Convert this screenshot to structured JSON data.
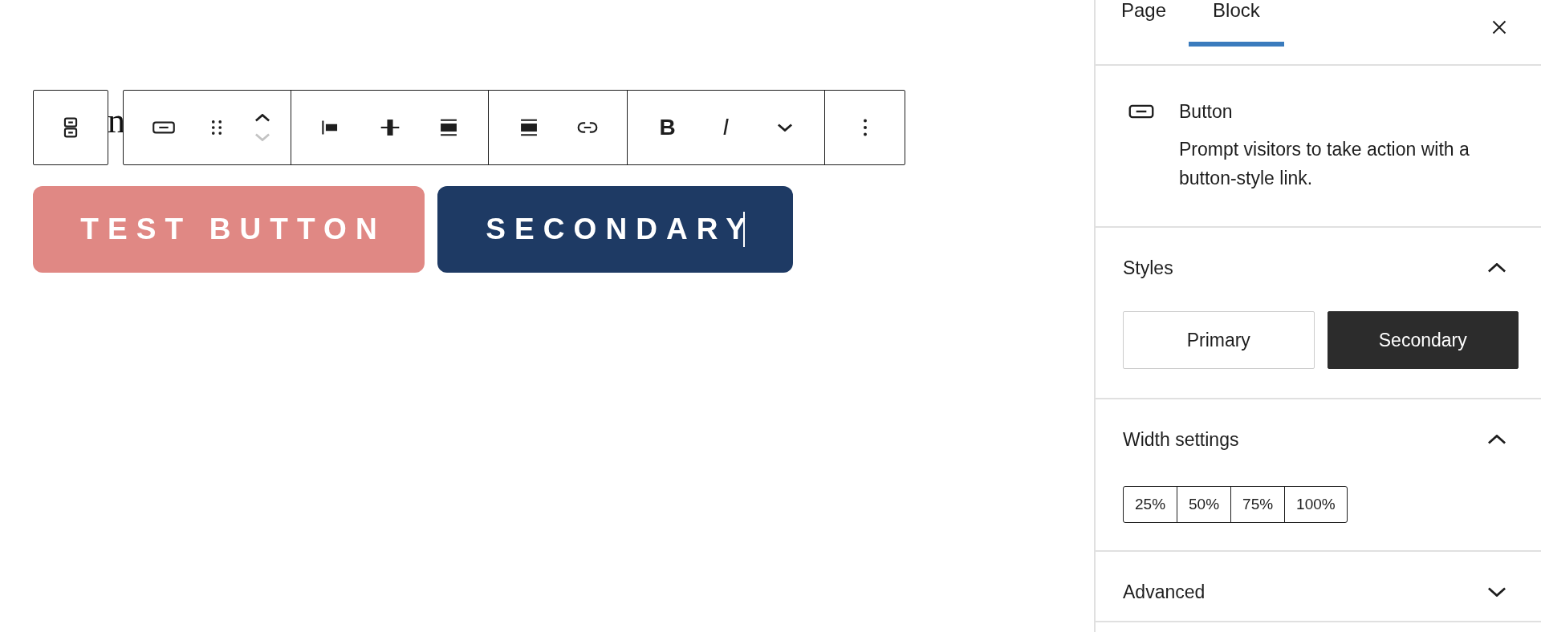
{
  "editor": {
    "heading_fragment": "n",
    "toolbar": {
      "groups": [
        {
          "kind": "parent",
          "items": [
            {
              "kind": "parent-select"
            }
          ]
        },
        {
          "kind": "block",
          "items": [
            {
              "kind": "button-block"
            },
            {
              "kind": "drag"
            },
            {
              "kind": "movers",
              "up_disabled": false,
              "down_disabled": true
            }
          ]
        },
        {
          "kind": "plain",
          "items": [
            {
              "kind": "align-left"
            },
            {
              "kind": "align-center"
            },
            {
              "kind": "align-wide"
            }
          ]
        },
        {
          "kind": "plain",
          "items": [
            {
              "kind": "align-full"
            },
            {
              "kind": "link"
            }
          ]
        },
        {
          "kind": "plain",
          "items": [
            {
              "kind": "bold",
              "text": "B"
            },
            {
              "kind": "italic",
              "text": "I"
            },
            {
              "kind": "more-formats"
            }
          ]
        },
        {
          "kind": "plain",
          "items": [
            {
              "kind": "options"
            }
          ]
        }
      ]
    },
    "buttons": [
      {
        "label": "TEST BUTTON",
        "color": "#e08884",
        "editing": false
      },
      {
        "label": "SECONDARY",
        "color": "#1e3a64",
        "editing": true
      }
    ]
  },
  "sidebar": {
    "tabs": [
      {
        "label": "Page",
        "selected": false
      },
      {
        "label": "Block",
        "selected": true
      }
    ],
    "block_card": {
      "title": "Button",
      "description": "Prompt visitors to take action with a button-style link."
    },
    "panels": [
      {
        "title": "Styles",
        "expanded": true,
        "kind": "styles",
        "options": [
          {
            "label": "Primary",
            "selected": false
          },
          {
            "label": "Secondary",
            "selected": true
          }
        ]
      },
      {
        "title": "Width settings",
        "expanded": true,
        "kind": "width",
        "options": [
          {
            "label": "25%",
            "selected": false
          },
          {
            "label": "50%",
            "selected": false
          },
          {
            "label": "75%",
            "selected": false
          },
          {
            "label": "100%",
            "selected": false
          }
        ]
      },
      {
        "title": "Advanced",
        "expanded": false
      }
    ]
  }
}
